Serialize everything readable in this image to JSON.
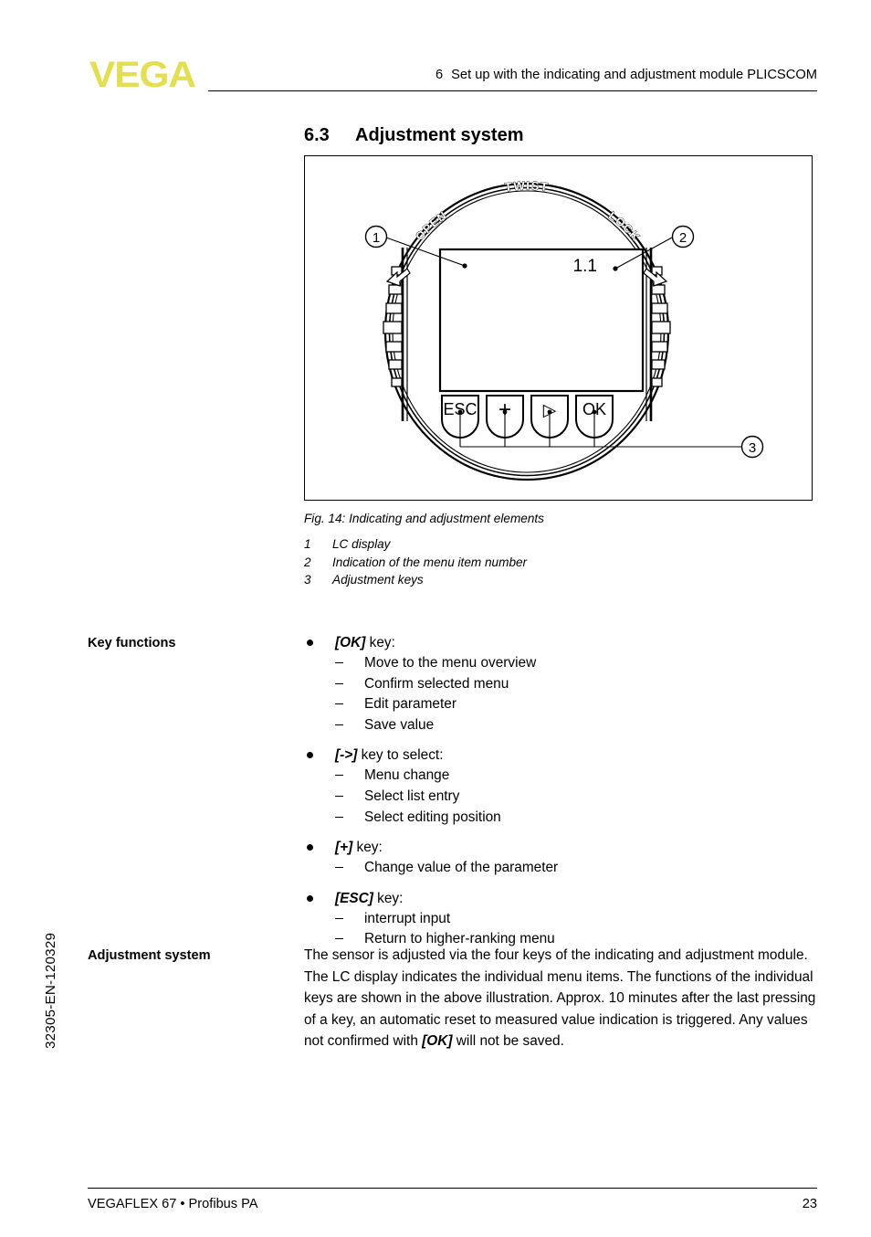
{
  "header": {
    "logo_text": "VEGA",
    "chapter_number": "6",
    "chapter_title": "Set up with the indicating and adjustment module PLICSCOM"
  },
  "section": {
    "number": "6.3",
    "title": "Adjustment system"
  },
  "figure": {
    "caption": "Fig. 14: Indicating and adjustment elements",
    "legend": [
      {
        "num": "1",
        "text": "LC display"
      },
      {
        "num": "2",
        "text": "Indication of the menu item number"
      },
      {
        "num": "3",
        "text": "Adjustment keys"
      }
    ],
    "device": {
      "twist_label": "TWIST",
      "open_label": "OPEN",
      "lock_label": "LOCK",
      "menu_item_number": "1.1",
      "keys": [
        {
          "label": "ESC",
          "name": "esc-key"
        },
        {
          "label": "+",
          "name": "plus-key"
        },
        {
          "label": "▷",
          "name": "right-arrow-key"
        },
        {
          "label": "OK",
          "name": "ok-key"
        }
      ],
      "callouts": [
        {
          "num": "1"
        },
        {
          "num": "2"
        },
        {
          "num": "3"
        }
      ]
    }
  },
  "key_functions": {
    "margin_label": "Key functions",
    "groups": [
      {
        "key": "[OK]",
        "suffix": " key:",
        "items": [
          "Move to the menu overview",
          "Confirm selected menu",
          "Edit parameter",
          "Save value"
        ]
      },
      {
        "key": "[->]",
        "suffix": " key to select:",
        "items": [
          "Menu change",
          "Select list entry",
          "Select editing position"
        ]
      },
      {
        "key": "[+]",
        "suffix": " key:",
        "items": [
          "Change value of the parameter"
        ]
      },
      {
        "key": "[ESC]",
        "suffix": " key:",
        "items": [
          "interrupt input",
          "Return to higher-ranking menu"
        ]
      }
    ]
  },
  "adjustment_system": {
    "margin_label": "Adjustment system",
    "paragraph_part1": "The sensor is adjusted via the four keys of the indicating and adjustment module. The LC display indicates the individual menu items. The functions of the individual keys are shown in the above illustration. Approx. 10 minutes after the last pressing of a key, an automatic reset to measured value indication is triggered. Any values not confirmed with ",
    "paragraph_key": "[OK]",
    "paragraph_part2": " will not be saved."
  },
  "doc_code": "32305-EN-120329",
  "footer": {
    "product": "VEGAFLEX 67 • Profibus PA",
    "page_number": "23"
  },
  "colors": {
    "brand_yellow": "#e4df4e",
    "ink": "#000000",
    "page": "#ffffff"
  }
}
